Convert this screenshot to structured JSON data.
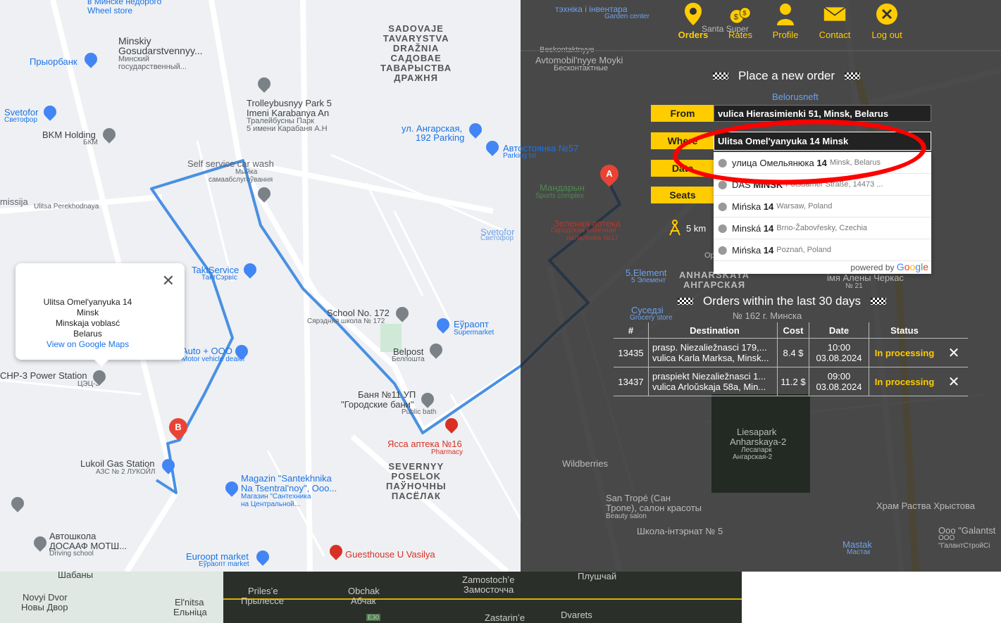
{
  "nav": {
    "items": [
      {
        "label": "Orders",
        "icon": "location-pin-icon"
      },
      {
        "label": "Rates",
        "icon": "money-bags-icon"
      },
      {
        "label": "Profile",
        "icon": "user-icon"
      },
      {
        "label": "Contact",
        "icon": "envelope-icon"
      },
      {
        "label": "Log out",
        "icon": "close-circle-icon"
      }
    ],
    "accent": "#ffcc00"
  },
  "form": {
    "title": "Place a new order",
    "from_label": "From",
    "from_value": "vulica Hierasimienki 51, Minsk, Belarus",
    "where_label": "Where",
    "where_value": "Ulitsa Omel'yanyuka 14 Minsk",
    "date_label": "Date",
    "seats_label": "Seats",
    "distance": "5 km"
  },
  "autocomplete": {
    "items": [
      {
        "main_pre": "улица Омельянюка ",
        "main_bold": "14",
        "secondary": "Minsk, Belarus"
      },
      {
        "main_pre": "DAS ",
        "main_bold": "MINSK",
        "secondary": "Potsdamer Straße, 14473 ..."
      },
      {
        "main_pre": "Mińska ",
        "main_bold": "14",
        "secondary": "Warsaw, Poland"
      },
      {
        "main_pre": "Minská ",
        "main_bold": "14",
        "secondary": "Brno-Žabovřesky, Czechia"
      },
      {
        "main_pre": "Mińska ",
        "main_bold": "14",
        "secondary": "Poznań, Poland"
      }
    ],
    "powered_by": "powered by"
  },
  "orders": {
    "title": "Orders within the last 30 days",
    "columns": [
      "#",
      "Destination",
      "Cost",
      "Date",
      "Status"
    ],
    "rows": [
      {
        "id": "13435",
        "from": "prasp. Niezaliežnasci 179,...",
        "to": "vulica Karla Marksa, Minsk...",
        "cost": "8.4 $",
        "time": "10:00",
        "date": "03.08.2024",
        "status": "In processing"
      },
      {
        "id": "13437",
        "from": "praspiekt Niezaliežnasci 1...",
        "to": "vulica Arloŭskaja 58a, Min...",
        "cost": "11.2 $",
        "time": "09:00",
        "date": "03.08.2024",
        "status": "In processing"
      }
    ]
  },
  "infowindow": {
    "line1": "Ulitsa Omel'yanyuka 14",
    "line2": "Minsk",
    "line3": "Minskaja voblasć",
    "line4": "Belarus",
    "link": "View on Google Maps"
  },
  "map": {
    "labels": {
      "wheel_store": "в Минске недорого\nWheel store",
      "minskiy": "Minskiy",
      "gosud": "Gosudarstvennyy...",
      "gosud_ru1": "Минский",
      "gosud_ru2": "государственный...",
      "priorbank": "Прыорбанк",
      "svetofor": "Svetofor",
      "svetofor_ru": "Светофор",
      "bkm": "BKM Holding",
      "bkm_ru": "БКМ",
      "sadovaje": "SADOVAJE\nTAVARYSTVA\nDRAŽNIA\nСАДОВАЕ\nТАВАРЫСТВА\nДРАЖНЯ",
      "trolley": "Trolleybusnyy Park 5",
      "trolley2": "Imeni Karabanya An",
      "trolley_ru": "Тралейбусны Парк",
      "trolley_ru2": "5 имени Карабаня А.Н",
      "parking": "ул. Ангарская,",
      "parking2": "192 Parking",
      "autostoyanka": "Автостоянка №57",
      "parking_lot": "Parking lot",
      "carwash": "Self service car wash",
      "carwash_ru": "Мыйка",
      "carwash_ru2": "самаабслугоўвання",
      "missija": "missija",
      "perekhodnaya": "Ulitsa Perekhodnaya",
      "taktservice": "TaktService",
      "taktservice_ru": "ТактСэрвіс",
      "school": "School No. 172",
      "school_ru": "Сярэдняя школа № 172",
      "euroopt": "Еўраопт",
      "supermarket": "Supermarket",
      "belpost": "Belpost",
      "belpost_ru": "Белпошта",
      "banya": "Баня №11 УП",
      "banya2": "\"Городские бани\"",
      "public_bath": "Public bath",
      "yassa": "Ясса аптека №16",
      "pharmacy": "Pharmacy",
      "severnyy": "SEVERNYY\nPOSELOK\nПАЎНОЧНЫ\nПАСЁЛАК",
      "chp": "CHP-3 Power Station",
      "chp_ru": "ЦЭЦ-3",
      "lukoil": "Lukoil Gas Station",
      "lukoil_ru": "АЗС № 2 ЛУКОЙЛ",
      "magazin": "Magazin \"Santekhnika",
      "magazin2": "Na Tsentral'noy\", Ooo...",
      "magazin_ru": "Магазин \"Сантехника",
      "magazin_ru2": "на Центральной...",
      "avtoshkola": "Автошкола",
      "dosaaf": "ДОСААФ МОТШ...",
      "driving": "Driving school",
      "euroopt_market": "Euroopt market",
      "euroopt_market_ru": "Еўраопт market",
      "guesthouse": "Guesthouse U Vasilya",
      "motorvehicle": "Motor vehicle dealer",
      "avto_ooo": "Auto + OOO",
      "svetofor2": "Svetofor",
      "svetofor2_ru": "Светофор",
      "mandarin": "Мандарын",
      "sports": "Sports complex",
      "zelenaya": "Зеленая аптека",
      "gorod": "Гарадская клінічная",
      "poly": "паліклініка №17",
      "element": "5.Element",
      "element_ru": "5 Элемент",
      "anharskaya": "ANHARSKAYA\nАНГАРСКАЯ",
      "susedi": "Суседзі",
      "grocery": "Grocery store",
      "school162": "№ 162 г. Минска",
      "belorusneft": "Belorusneft",
      "avtomobil": "Avtomobil'nyye Moyki",
      "beskontakt": "Бесконтактные",
      "beskontakt2": "Beskontaktnyye",
      "tekhniki": "тэхніка і інвентара",
      "garden": "Garden center",
      "santa": "Santa Super",
      "liesapark": "Liesapark",
      "anharskaya2": "Anharskaya-2",
      "lesopark_ru": "Лесапарк",
      "anharskaya2_ru": "Ангарская-2",
      "wildberries": "Wildberries",
      "santrope": "San Tropé (Сан",
      "santrope2": "Тропе), салон красоты",
      "beauty": "Beauty salon",
      "shkola5": "Школа-інтэрнат № 5",
      "hram": "Храм Раства Хрыстова",
      "ooo_g": "Ooo \"Galantst",
      "ooo_g2": "ООО",
      "ooo_g3": "\"ГалантСтройСі",
      "mastak": "Mastak",
      "mastak_ru": "Мастак",
      "alena": "імя Алены Черкас",
      "alena2": "№ 21",
      "shabany": "Шабаны",
      "novyi": "Novyi Dvor",
      "novyi_ru": "Новы Двор",
      "elnitsa": "El'nitsa",
      "elnitsa_ru": "Ельніца",
      "prilese": "Prilesʼe",
      "prilese_ru": "Прылессе",
      "obchak": "Obchak",
      "obchak_ru": "Абчак",
      "zamostoche": "Zamostochʼe",
      "zamostoche_ru": "Замосточча",
      "pluschai": "Плушчай",
      "zastarine": "Zastarinʼe",
      "dvarets": "Dvarets",
      "op": "Op",
      "e30": "E30"
    }
  }
}
